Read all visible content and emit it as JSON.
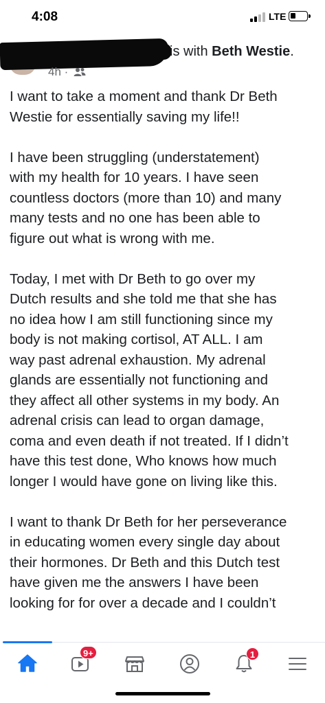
{
  "status_bar": {
    "time": "4:08",
    "network": "LTE",
    "signal_bars_active": 2,
    "signal_bars_total": 4
  },
  "post": {
    "author_redacted": true,
    "with_text": "is with ",
    "tagged_person": "Beth Westie",
    "tagged_suffix": ".",
    "time_ago": "4h",
    "separator": " · ",
    "audience_icon": "friends-icon",
    "paragraphs": [
      [
        "I want to take a moment and thank Dr Beth",
        "Westie for essentially saving my life!!"
      ],
      [
        "I have been struggling (understatement)",
        "with my health for 10 years. I have seen",
        "countless doctors (more than 10) and many",
        "many tests and no one has been able to",
        "figure out what is wrong with me."
      ],
      [
        "Today, I met with Dr Beth to go over my",
        "Dutch results and she told me that she has",
        "no idea how I am still functioning since my",
        "body is not making cortisol, AT ALL. I am",
        "way past adrenal exhaustion. My adrenal",
        "glands are essentially not functioning and",
        "they affect all other systems in my body. An",
        "adrenal crisis can lead to organ damage,",
        "coma and even death if not treated. If I didn’t",
        "have this test done, Who knows how much",
        "longer I would have gone on living like this."
      ],
      [
        "I want to thank Dr Beth for her perseverance",
        "in educating women every single day about",
        "their hormones. Dr Beth and this Dutch test",
        "have given me the answers I have been",
        "looking for for over a decade and I couldn’t"
      ]
    ]
  },
  "tab_bar": {
    "active_tab": "home",
    "tabs": [
      {
        "id": "home",
        "icon": "home-icon",
        "badge": ""
      },
      {
        "id": "video",
        "icon": "video-icon",
        "badge": "9+"
      },
      {
        "id": "marketplace",
        "icon": "marketplace-icon",
        "badge": ""
      },
      {
        "id": "profile",
        "icon": "profile-icon",
        "badge": ""
      },
      {
        "id": "notifications",
        "icon": "bell-icon",
        "badge": "1"
      },
      {
        "id": "menu",
        "icon": "menu-icon",
        "badge": ""
      }
    ]
  },
  "colors": {
    "accent": "#1877f2",
    "badge": "#e41e3f",
    "text": "#1c1e21",
    "secondary_text": "#65676b",
    "icon_inactive": "#65676b"
  }
}
